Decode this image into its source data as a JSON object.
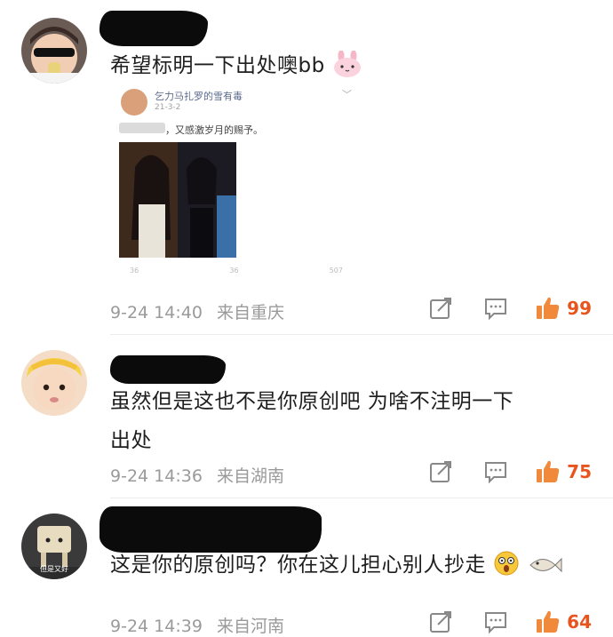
{
  "comments": [
    {
      "text": "希望标明一下出处噢bb",
      "date": "9-24 14:40",
      "location": "来自重庆",
      "likes": "99",
      "quoted_post": {
        "author": "乞力马扎罗的雪有毒",
        "date": "21-3-2",
        "text": "，又感激岁月的赐予。",
        "stats": [
          "36",
          "36",
          "507"
        ]
      }
    },
    {
      "text_line1": "虽然但是这也不是你原创吧 为啥不注明一下",
      "text_line2": "出处",
      "date": "9-24 14:36",
      "location": "来自湖南",
      "likes": "75"
    },
    {
      "text": "这是你的原创吗？你在这儿担心别人抄走",
      "date": "9-24 14:39",
      "location": "来自河南",
      "likes": "64",
      "avatar_caption": "但是又好"
    }
  ],
  "icons": {
    "share": "share-icon",
    "reply": "comment-icon",
    "like": "thumbs-up-icon"
  },
  "colors": {
    "like_count": "#e8541e",
    "meta_text": "#9a9a9a",
    "redaction": "#0b0b0b"
  }
}
